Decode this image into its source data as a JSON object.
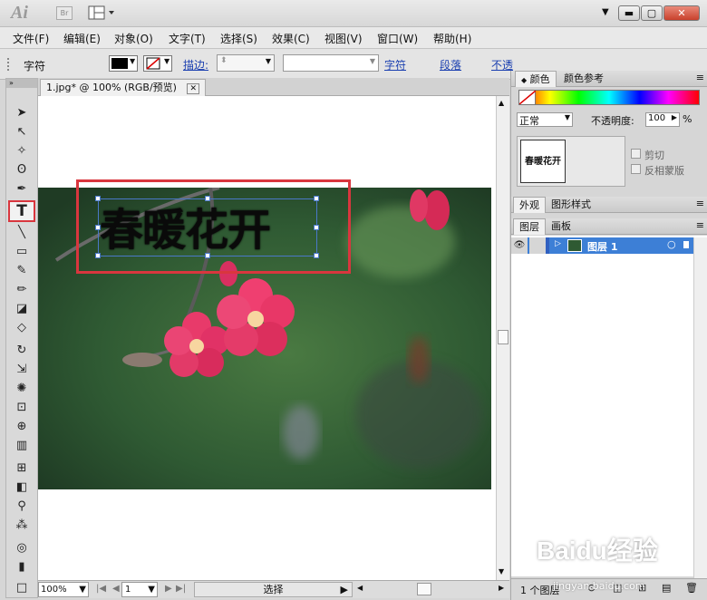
{
  "titlebar": {
    "logo": "Ai",
    "bridge_label": "Br",
    "window_buttons": {
      "minimize": "▬",
      "restore": "▢",
      "close": "✕"
    }
  },
  "menu": [
    "文件(F)",
    "编辑(E)",
    "对象(O)",
    "文字(T)",
    "选择(S)",
    "效果(C)",
    "视图(V)",
    "窗口(W)",
    "帮助(H)"
  ],
  "control_bar": {
    "label": "字符",
    "stroke_label": "描边:",
    "links": [
      "字符",
      "段落",
      "不透"
    ]
  },
  "document": {
    "tab_title": "1.jpg* @ 100% (RGB/预览)",
    "art_text": "春暖花开",
    "zoom": "100%",
    "page": "1",
    "status_tool": "选择"
  },
  "panels": {
    "color_tabs": [
      "颜色",
      "颜色参考"
    ],
    "transparency": {
      "mode": "正常",
      "opacity_label": "不透明度:",
      "opacity_value": "100",
      "opacity_unit": "%",
      "clip_label": "剪切",
      "invert_label": "反相蒙版"
    },
    "appearance_tabs": [
      "外观",
      "图形样式"
    ],
    "layer_tabs": [
      "图层",
      "画板"
    ],
    "layer_name": "图层 1",
    "layer_count": "1 个图层",
    "thumbnail_text": "春暖花开"
  },
  "watermark": {
    "brand": "Baidu经验",
    "url": "jingyan.baidu.com"
  },
  "colors": {
    "highlight": "#d9363e",
    "selection": "#3d7fd6",
    "link": "#1a3fb0"
  }
}
